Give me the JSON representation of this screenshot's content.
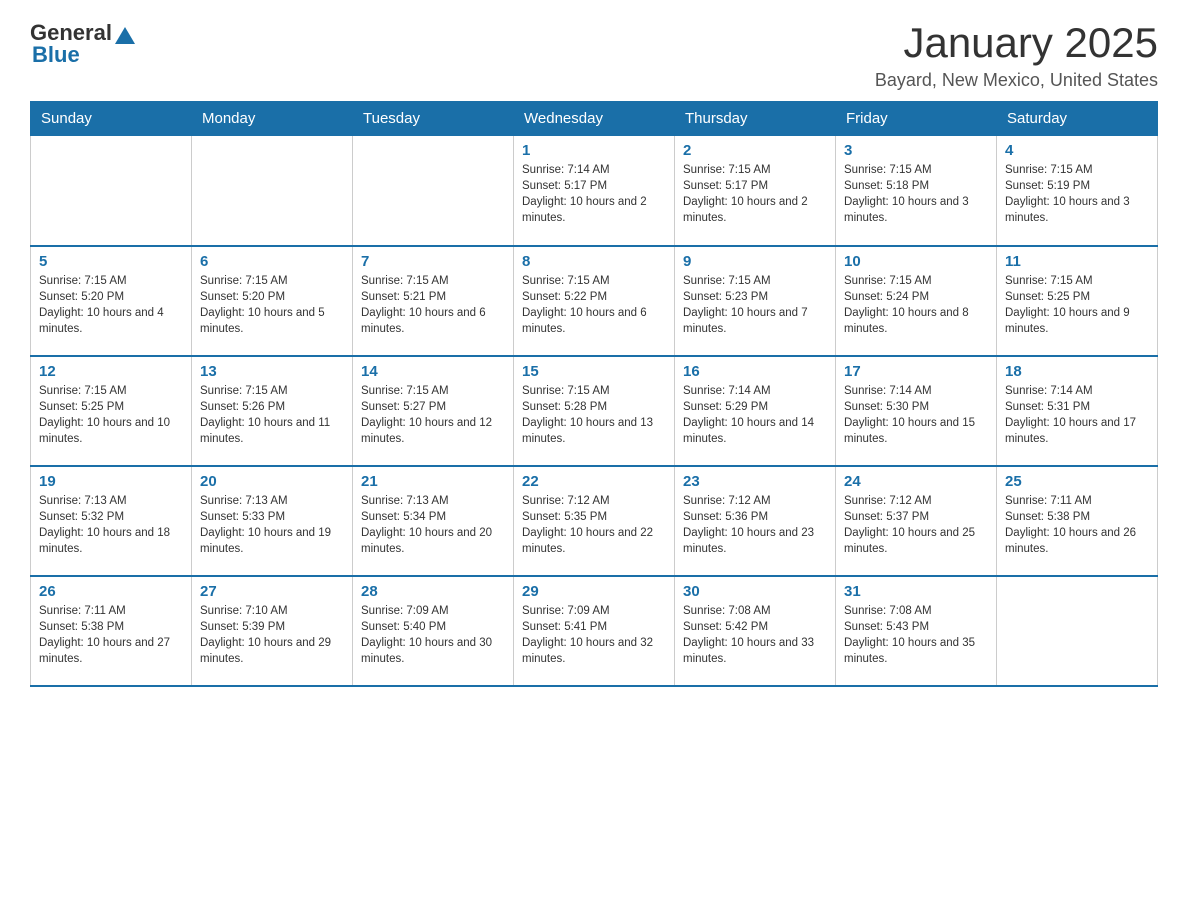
{
  "logo": {
    "general": "General",
    "blue": "Blue"
  },
  "title": "January 2025",
  "subtitle": "Bayard, New Mexico, United States",
  "days_of_week": [
    "Sunday",
    "Monday",
    "Tuesday",
    "Wednesday",
    "Thursday",
    "Friday",
    "Saturday"
  ],
  "weeks": [
    [
      {
        "date": "",
        "info": ""
      },
      {
        "date": "",
        "info": ""
      },
      {
        "date": "",
        "info": ""
      },
      {
        "date": "1",
        "info": "Sunrise: 7:14 AM\nSunset: 5:17 PM\nDaylight: 10 hours and 2 minutes."
      },
      {
        "date": "2",
        "info": "Sunrise: 7:15 AM\nSunset: 5:17 PM\nDaylight: 10 hours and 2 minutes."
      },
      {
        "date": "3",
        "info": "Sunrise: 7:15 AM\nSunset: 5:18 PM\nDaylight: 10 hours and 3 minutes."
      },
      {
        "date": "4",
        "info": "Sunrise: 7:15 AM\nSunset: 5:19 PM\nDaylight: 10 hours and 3 minutes."
      }
    ],
    [
      {
        "date": "5",
        "info": "Sunrise: 7:15 AM\nSunset: 5:20 PM\nDaylight: 10 hours and 4 minutes."
      },
      {
        "date": "6",
        "info": "Sunrise: 7:15 AM\nSunset: 5:20 PM\nDaylight: 10 hours and 5 minutes."
      },
      {
        "date": "7",
        "info": "Sunrise: 7:15 AM\nSunset: 5:21 PM\nDaylight: 10 hours and 6 minutes."
      },
      {
        "date": "8",
        "info": "Sunrise: 7:15 AM\nSunset: 5:22 PM\nDaylight: 10 hours and 6 minutes."
      },
      {
        "date": "9",
        "info": "Sunrise: 7:15 AM\nSunset: 5:23 PM\nDaylight: 10 hours and 7 minutes."
      },
      {
        "date": "10",
        "info": "Sunrise: 7:15 AM\nSunset: 5:24 PM\nDaylight: 10 hours and 8 minutes."
      },
      {
        "date": "11",
        "info": "Sunrise: 7:15 AM\nSunset: 5:25 PM\nDaylight: 10 hours and 9 minutes."
      }
    ],
    [
      {
        "date": "12",
        "info": "Sunrise: 7:15 AM\nSunset: 5:25 PM\nDaylight: 10 hours and 10 minutes."
      },
      {
        "date": "13",
        "info": "Sunrise: 7:15 AM\nSunset: 5:26 PM\nDaylight: 10 hours and 11 minutes."
      },
      {
        "date": "14",
        "info": "Sunrise: 7:15 AM\nSunset: 5:27 PM\nDaylight: 10 hours and 12 minutes."
      },
      {
        "date": "15",
        "info": "Sunrise: 7:15 AM\nSunset: 5:28 PM\nDaylight: 10 hours and 13 minutes."
      },
      {
        "date": "16",
        "info": "Sunrise: 7:14 AM\nSunset: 5:29 PM\nDaylight: 10 hours and 14 minutes."
      },
      {
        "date": "17",
        "info": "Sunrise: 7:14 AM\nSunset: 5:30 PM\nDaylight: 10 hours and 15 minutes."
      },
      {
        "date": "18",
        "info": "Sunrise: 7:14 AM\nSunset: 5:31 PM\nDaylight: 10 hours and 17 minutes."
      }
    ],
    [
      {
        "date": "19",
        "info": "Sunrise: 7:13 AM\nSunset: 5:32 PM\nDaylight: 10 hours and 18 minutes."
      },
      {
        "date": "20",
        "info": "Sunrise: 7:13 AM\nSunset: 5:33 PM\nDaylight: 10 hours and 19 minutes."
      },
      {
        "date": "21",
        "info": "Sunrise: 7:13 AM\nSunset: 5:34 PM\nDaylight: 10 hours and 20 minutes."
      },
      {
        "date": "22",
        "info": "Sunrise: 7:12 AM\nSunset: 5:35 PM\nDaylight: 10 hours and 22 minutes."
      },
      {
        "date": "23",
        "info": "Sunrise: 7:12 AM\nSunset: 5:36 PM\nDaylight: 10 hours and 23 minutes."
      },
      {
        "date": "24",
        "info": "Sunrise: 7:12 AM\nSunset: 5:37 PM\nDaylight: 10 hours and 25 minutes."
      },
      {
        "date": "25",
        "info": "Sunrise: 7:11 AM\nSunset: 5:38 PM\nDaylight: 10 hours and 26 minutes."
      }
    ],
    [
      {
        "date": "26",
        "info": "Sunrise: 7:11 AM\nSunset: 5:38 PM\nDaylight: 10 hours and 27 minutes."
      },
      {
        "date": "27",
        "info": "Sunrise: 7:10 AM\nSunset: 5:39 PM\nDaylight: 10 hours and 29 minutes."
      },
      {
        "date": "28",
        "info": "Sunrise: 7:09 AM\nSunset: 5:40 PM\nDaylight: 10 hours and 30 minutes."
      },
      {
        "date": "29",
        "info": "Sunrise: 7:09 AM\nSunset: 5:41 PM\nDaylight: 10 hours and 32 minutes."
      },
      {
        "date": "30",
        "info": "Sunrise: 7:08 AM\nSunset: 5:42 PM\nDaylight: 10 hours and 33 minutes."
      },
      {
        "date": "31",
        "info": "Sunrise: 7:08 AM\nSunset: 5:43 PM\nDaylight: 10 hours and 35 minutes."
      },
      {
        "date": "",
        "info": ""
      }
    ]
  ]
}
